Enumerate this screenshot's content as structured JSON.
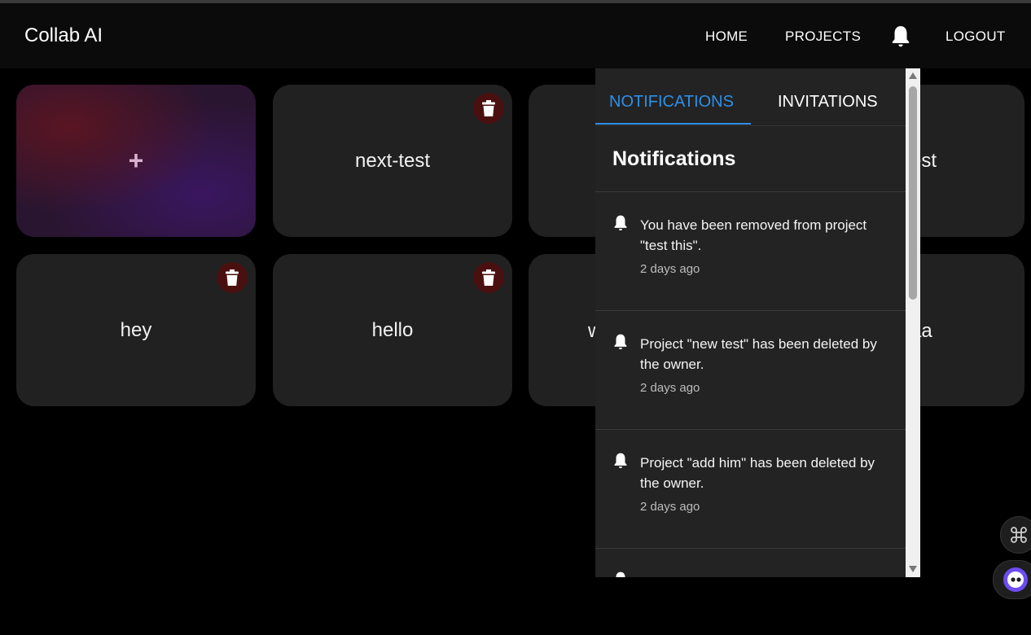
{
  "app": {
    "title": "Collab AI"
  },
  "nav": {
    "home": "HOME",
    "projects": "PROJECTS",
    "logout": "LOGOUT"
  },
  "new_project": {
    "label": "+"
  },
  "projects": [
    {
      "name": "next-test"
    },
    {
      "name": "est"
    },
    {
      "name": "hey"
    },
    {
      "name": "hello"
    },
    {
      "name": "w"
    },
    {
      "name": "aa"
    }
  ],
  "panel": {
    "tabs": [
      "NOTIFICATIONS",
      "INVITATIONS"
    ],
    "active_tab": "NOTIFICATIONS",
    "heading": "Notifications",
    "notifications": [
      {
        "text": "You have been removed from project \"test this\".",
        "time": "2 days ago"
      },
      {
        "text": "Project \"new test\" has been deleted by the owner.",
        "time": "2 days ago"
      },
      {
        "text": "Project \"add him\" has been deleted by the owner.",
        "time": "2 days ago"
      }
    ]
  },
  "colors": {
    "accent": "#2f8fe6",
    "card": "#212121",
    "delete_bg": "#4a1010",
    "panel": "#232323"
  },
  "icons": {
    "nav": "bell-icon",
    "delete": "trash-icon",
    "notification": "bell-icon"
  }
}
